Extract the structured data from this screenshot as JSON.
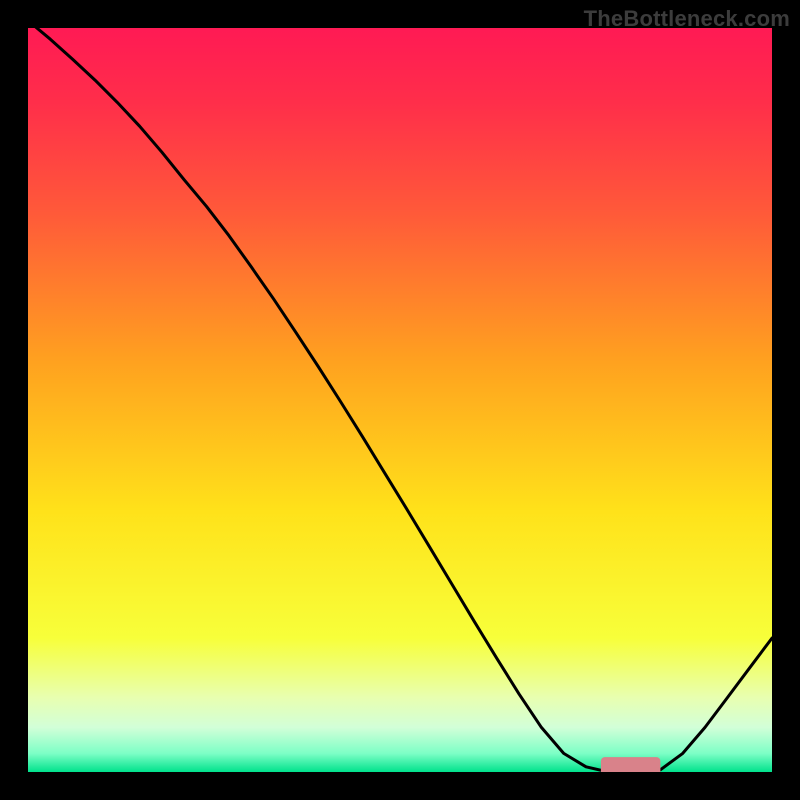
{
  "watermark": "TheBottleneck.com",
  "colors": {
    "frame": "#000000",
    "curve_stroke": "#000000",
    "marker_fill": "#d9828a",
    "gradient_stops": [
      {
        "offset": 0.0,
        "color": "#ff1a54"
      },
      {
        "offset": 0.1,
        "color": "#ff2e4a"
      },
      {
        "offset": 0.25,
        "color": "#ff5a39"
      },
      {
        "offset": 0.45,
        "color": "#ffa21f"
      },
      {
        "offset": 0.65,
        "color": "#ffe21a"
      },
      {
        "offset": 0.82,
        "color": "#f7ff3a"
      },
      {
        "offset": 0.9,
        "color": "#e8ffb0"
      },
      {
        "offset": 0.94,
        "color": "#d2ffd8"
      },
      {
        "offset": 0.975,
        "color": "#7dffc6"
      },
      {
        "offset": 1.0,
        "color": "#00e28c"
      }
    ]
  },
  "chart_data": {
    "type": "line",
    "title": "",
    "xlabel": "",
    "ylabel": "",
    "xlim": [
      0,
      100
    ],
    "ylim": [
      0,
      100
    ],
    "x": [
      0.0,
      3,
      6,
      9,
      12,
      15,
      18,
      21,
      24,
      27,
      30,
      33,
      36,
      39,
      42,
      45,
      48,
      51,
      54,
      57,
      60,
      63,
      66,
      69,
      72,
      75,
      78,
      80,
      82,
      85,
      88,
      91,
      94,
      97,
      100
    ],
    "values": [
      101.0,
      98.5,
      95.8,
      93.0,
      90.0,
      86.8,
      83.3,
      79.6,
      76.0,
      72.1,
      67.9,
      63.6,
      59.1,
      54.5,
      49.8,
      45.0,
      40.1,
      35.2,
      30.2,
      25.2,
      20.2,
      15.3,
      10.5,
      6.0,
      2.5,
      0.7,
      0.0,
      0.0,
      0.0,
      0.3,
      2.5,
      6.0,
      10.0,
      14.0,
      18.0
    ],
    "marker": {
      "x_start": 77,
      "x_end": 85,
      "y": 0.5,
      "thickness": 3
    }
  }
}
